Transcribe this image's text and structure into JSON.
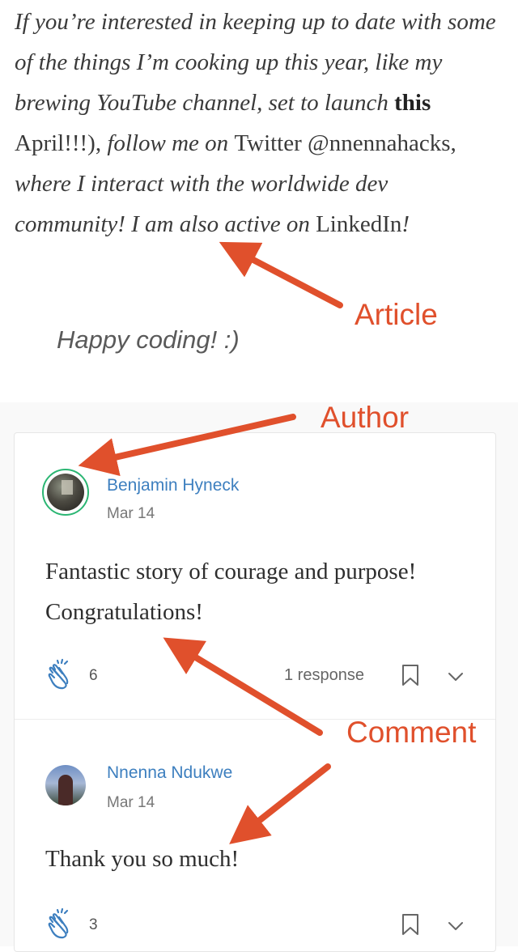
{
  "article": {
    "paragraph": {
      "s1": "If you’re interested in keeping up to date with some of the things I’m cooking up this year, like my brewing YouTube channel, set to launch ",
      "s2": "this",
      "s3": " April!!!), ",
      "s4": "follow me on ",
      "s5": "Twitter @nnennahacks,",
      "s6": " where I interact with the worldwide dev community! I am also active on ",
      "s7": "LinkedIn",
      "s8": "!"
    },
    "signoff": "Happy coding! :)"
  },
  "responses": [
    {
      "author": "Benjamin Hyneck",
      "date": "Mar 14",
      "text": "Fantastic story of courage and purpose! Congratulations!",
      "claps": "6",
      "responses_label": "1 response"
    },
    {
      "author": "Nnenna Ndukwe",
      "date": "Mar 14",
      "text": "Thank you so much!",
      "claps": "3"
    }
  ],
  "annotations": {
    "article": "Article",
    "author": "Author",
    "comment": "Comment"
  },
  "colors": {
    "annotation": "#e0502c",
    "author_link": "#3d7fbf",
    "clap": "#3d7fbf",
    "avatar_ring": "#2bb673"
  },
  "icons": [
    "clap-icon",
    "bookmark-icon",
    "chevron-down-icon"
  ]
}
